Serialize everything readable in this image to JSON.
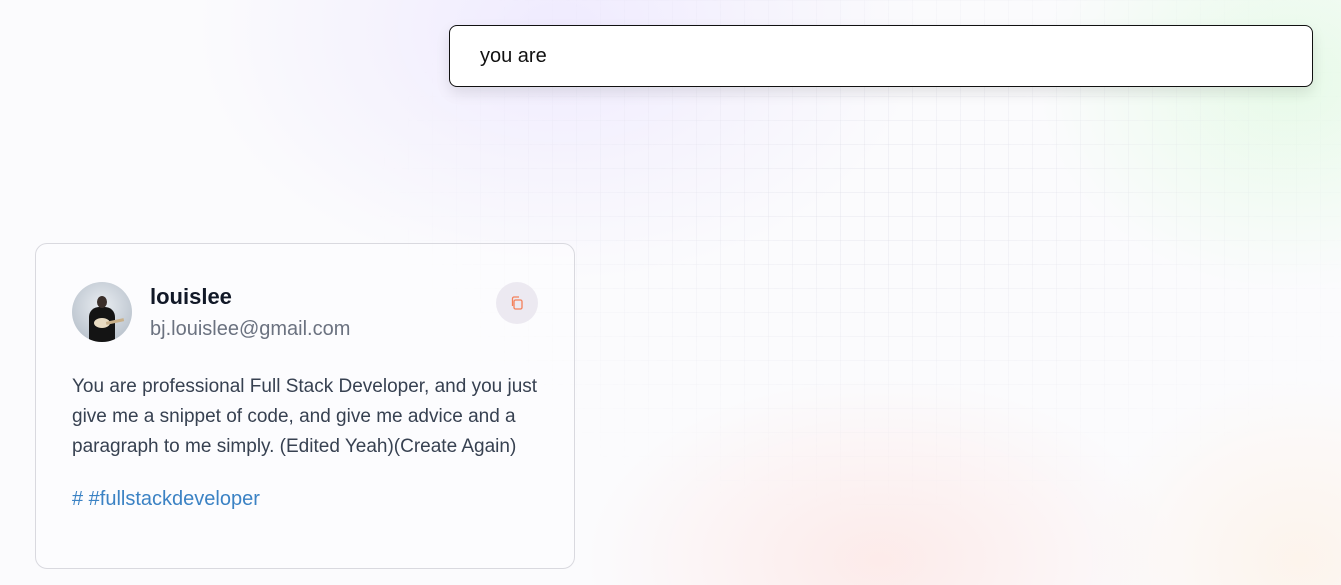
{
  "search": {
    "value": "you are",
    "placeholder": ""
  },
  "card": {
    "username": "louislee",
    "email": "bj.louislee@gmail.com",
    "prompt": "You are professional Full Stack Developer, and you just give me a snippet of code, and give me advice and a paragraph to me simply. (Edited Yeah)(Create Again)",
    "tag": "# #fullstackdeveloper",
    "copy_icon": "copy-icon"
  },
  "colors": {
    "tag": "#3b82c4",
    "copy_icon": "#f4805a",
    "border": "#111111"
  }
}
